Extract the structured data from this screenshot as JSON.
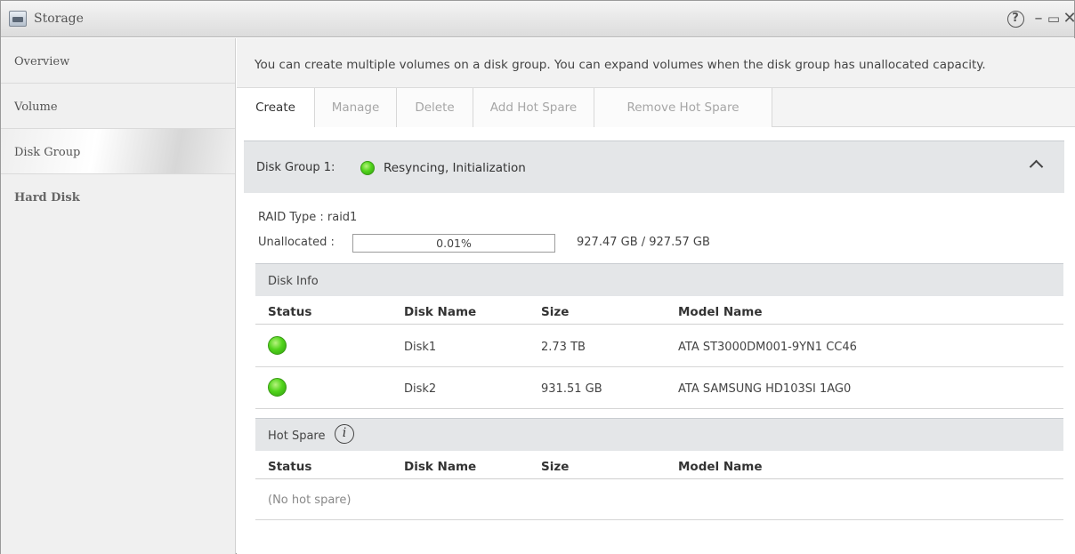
{
  "window": {
    "title": "Storage"
  },
  "sidebar": {
    "items": [
      {
        "label": "Overview"
      },
      {
        "label": "Volume"
      },
      {
        "label": "Disk Group"
      },
      {
        "label": "Hard Disk"
      }
    ]
  },
  "banner": {
    "text": "You can create multiple volumes on a disk group. You can expand volumes when the disk group has unallocated capacity."
  },
  "toolbar": {
    "create": "Create",
    "manage": "Manage",
    "delete": "Delete",
    "add_hot_spare": "Add Hot Spare",
    "remove_hot_spare": "Remove Hot Spare"
  },
  "disk_group": {
    "label": "Disk Group 1:",
    "status": "Resyncing, Initialization",
    "status_color": "#52d41c",
    "raid_type_text": "RAID Type  :  raid1",
    "unallocated_label": "Unallocated :",
    "unallocated_percent_text": "0.01%",
    "unallocated_fraction": 0.0001,
    "capacity_text": "927.47 GB / 927.57 GB"
  },
  "disk_info": {
    "title": "Disk Info",
    "columns": [
      "Status",
      "Disk Name",
      "Size",
      "Model Name"
    ],
    "rows": [
      {
        "name": "Disk1",
        "size": "2.73 TB",
        "model": "ATA ST3000DM001-9YN1 CC46"
      },
      {
        "name": "Disk2",
        "size": "931.51 GB",
        "model": "ATA SAMSUNG HD103SI 1AG0"
      }
    ]
  },
  "hot_spare": {
    "title": "Hot Spare",
    "info_icon": "i",
    "columns": [
      "Status",
      "Disk Name",
      "Size",
      "Model Name"
    ],
    "empty_text": "(No hot spare)"
  }
}
